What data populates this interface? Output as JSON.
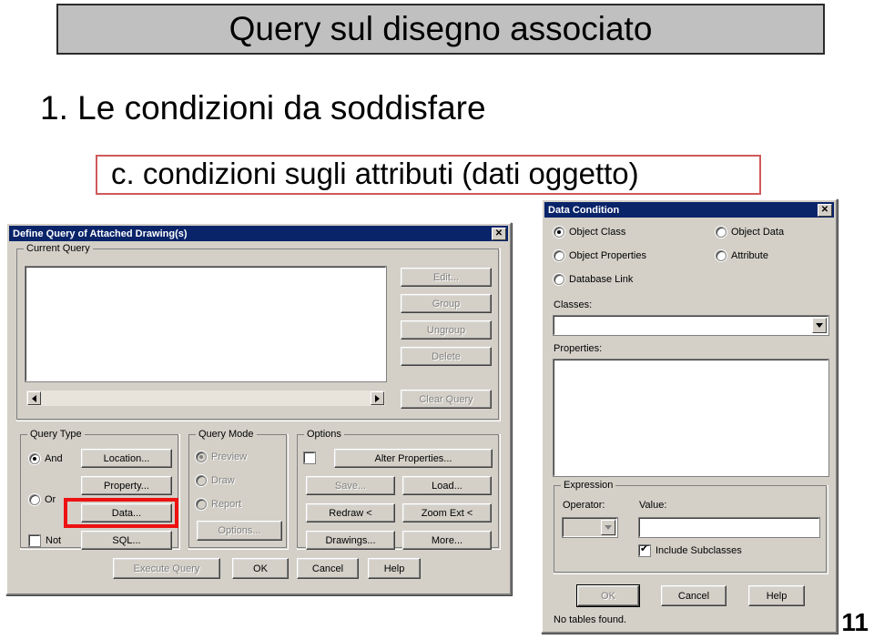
{
  "slide": {
    "title": "Query sul disegno associato",
    "bullet": "1. Le condizioni da soddisfare",
    "callout": "c. condizioni sugli attributi (dati oggetto)",
    "page_number": "11",
    "accent_red": "#d05a5a",
    "highlight_red": "#ee1111",
    "title_box_bg": "#c0c0c0"
  },
  "define_query_dialog": {
    "title": "Define Query of Attached Drawing(s)",
    "close_glyph": "✕",
    "current_query": {
      "legend": "Current Query",
      "list_value": "",
      "scroll_left_glyph": "◄",
      "scroll_right_glyph": "►"
    },
    "side_buttons": [
      {
        "label": "Edit...",
        "disabled": true
      },
      {
        "label": "Group",
        "disabled": true
      },
      {
        "label": "Ungroup",
        "disabled": true
      },
      {
        "label": "Delete",
        "disabled": true
      },
      {
        "label": "Clear Query",
        "disabled": true
      }
    ],
    "query_type": {
      "legend": "Query Type",
      "radios": [
        {
          "label": "And",
          "checked": true
        },
        {
          "label": "Or",
          "checked": false
        }
      ],
      "not_checkbox": {
        "label": "Not",
        "checked": false
      },
      "buttons": [
        {
          "label": "Location...",
          "disabled": false
        },
        {
          "label": "Property...",
          "disabled": false
        },
        {
          "label": "Data...",
          "disabled": false
        },
        {
          "label": "SQL...",
          "disabled": false
        }
      ]
    },
    "query_mode": {
      "legend": "Query Mode",
      "radios": [
        {
          "label": "Preview",
          "checked": true,
          "disabled": true
        },
        {
          "label": "Draw",
          "checked": false,
          "disabled": true
        },
        {
          "label": "Report",
          "checked": false,
          "disabled": true
        }
      ],
      "options_button": {
        "label": "Options...",
        "disabled": true
      }
    },
    "options": {
      "legend": "Options",
      "alter_checkbox": {
        "label": "",
        "checked": false
      },
      "buttons": [
        {
          "label": "Alter Properties...",
          "disabled": false
        },
        {
          "label": "Save...",
          "disabled": true
        },
        {
          "label": "Load...",
          "disabled": false
        },
        {
          "label": "Redraw <",
          "disabled": false
        },
        {
          "label": "Zoom Ext <",
          "disabled": false
        },
        {
          "label": "Drawings...",
          "disabled": false
        },
        {
          "label": "More...",
          "disabled": false
        }
      ]
    },
    "footer_buttons": [
      {
        "label": "Execute Query",
        "disabled": true
      },
      {
        "label": "OK",
        "disabled": false
      },
      {
        "label": "Cancel",
        "disabled": false
      },
      {
        "label": "Help",
        "disabled": false
      }
    ]
  },
  "data_condition_dialog": {
    "title": "Data Condition",
    "close_glyph": "✕",
    "condition_radios": [
      {
        "label": "Object Class",
        "checked": true
      },
      {
        "label": "Object Data",
        "checked": false
      },
      {
        "label": "Object Properties",
        "checked": false
      },
      {
        "label": "Attribute",
        "checked": false
      },
      {
        "label": "Database Link",
        "checked": false
      }
    ],
    "classes_label": "Classes:",
    "classes_value": "",
    "properties_label": "Properties:",
    "properties_value": "",
    "expression": {
      "legend": "Expression",
      "operator_label": "Operator:",
      "operator_value": "",
      "value_label": "Value:",
      "value_value": "",
      "include_subclasses": {
        "label": "Include Subclasses",
        "checked": true
      }
    },
    "footer_buttons": [
      {
        "label": "OK",
        "disabled": true
      },
      {
        "label": "Cancel",
        "disabled": false
      },
      {
        "label": "Help",
        "disabled": false
      }
    ],
    "status_text": "No tables found."
  }
}
